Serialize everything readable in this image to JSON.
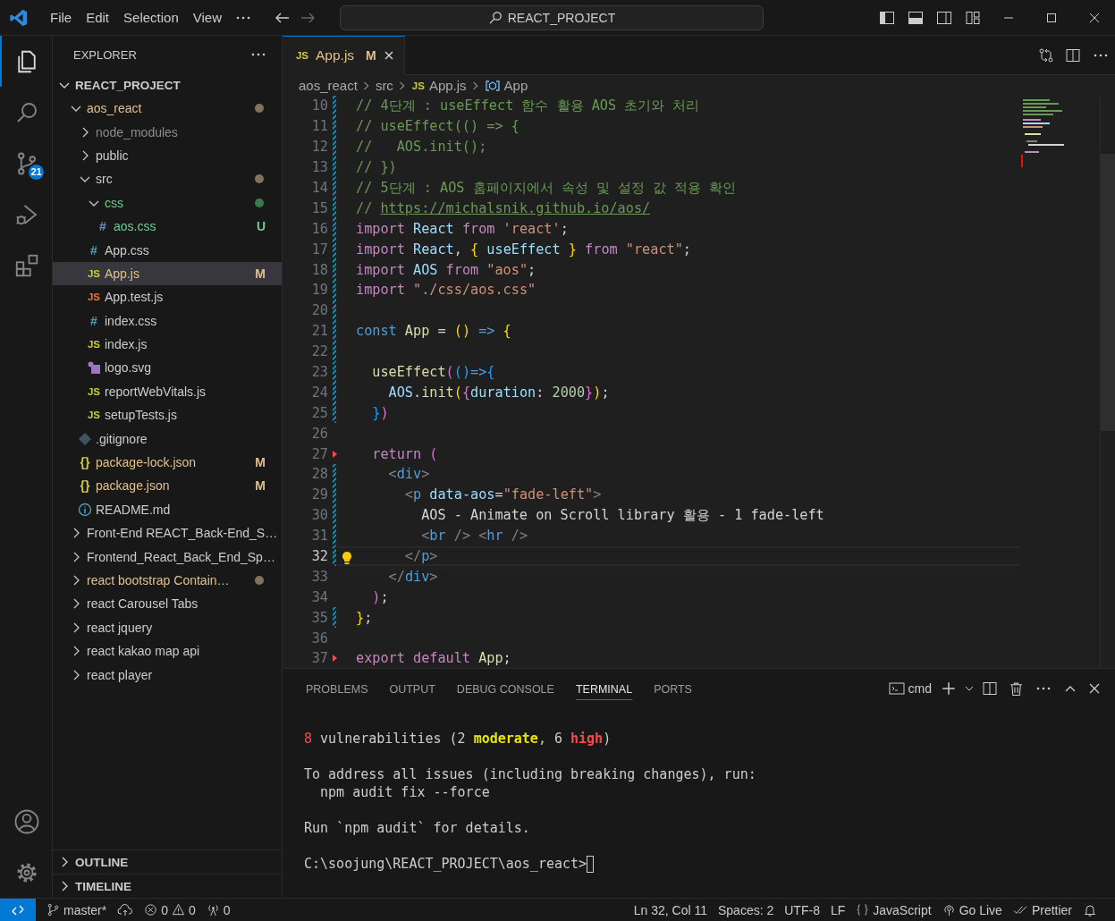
{
  "title_bar": {
    "menus": [
      {
        "label": "File"
      },
      {
        "label": "Edit"
      },
      {
        "label": "Selection"
      },
      {
        "label": "View"
      }
    ],
    "command_center": {
      "label": "REACT_PROJECT"
    }
  },
  "activity_bar": {
    "items": [
      {
        "kind": "explorer",
        "selected": true
      },
      {
        "kind": "search",
        "selected": false
      },
      {
        "kind": "source_control",
        "selected": false,
        "badge": "21"
      },
      {
        "kind": "run_debug",
        "selected": false
      },
      {
        "kind": "extensions",
        "selected": false
      }
    ],
    "bottom": [
      {
        "kind": "accounts"
      },
      {
        "kind": "settings"
      }
    ]
  },
  "sidebar": {
    "title": "EXPLORER",
    "section": {
      "label": "REACT_PROJECT",
      "expanded": true
    },
    "tree": [
      {
        "kind": "folder",
        "label": "aos_react",
        "expanded": true,
        "color": "#e2c08d",
        "dot": {
          "color": "#857359"
        },
        "selected": false,
        "children": [
          {
            "kind": "folder",
            "label": "node_modules",
            "expanded": false,
            "color": "#8c8c8c",
            "selected": false
          },
          {
            "kind": "folder",
            "label": "public",
            "expanded": false,
            "color": "#cccccc",
            "selected": false
          },
          {
            "kind": "folder",
            "label": "src",
            "expanded": true,
            "color": "#cccccc",
            "dot": {
              "color": "#857359"
            },
            "selected": false,
            "children": [
              {
                "kind": "folder",
                "label": "css",
                "expanded": true,
                "color": "#73c991",
                "dot": {
                  "color": "#3f7a4f"
                },
                "selected": false,
                "children": [
                  {
                    "kind": "css",
                    "glyph": "#",
                    "label": "aos.css",
                    "color": "#73c991",
                    "badge": "U",
                    "selected": false
                  }
                ]
              },
              {
                "kind": "css",
                "glyph": "#",
                "label": "App.css",
                "color": "#cccccc",
                "selected": false
              },
              {
                "kind": "js",
                "glyph": "JS",
                "label": "App.js",
                "color": "#e2c08d",
                "badge": "M",
                "selected": true
              },
              {
                "kind": "jstest",
                "glyph": "JS",
                "label": "App.test.js",
                "color": "#cccccc",
                "selected": false
              },
              {
                "kind": "css",
                "glyph": "#",
                "label": "index.css",
                "color": "#cccccc",
                "selected": false
              },
              {
                "kind": "js",
                "glyph": "JS",
                "label": "index.js",
                "color": "#cccccc",
                "selected": false
              },
              {
                "kind": "image",
                "label": "logo.svg",
                "color": "#cccccc",
                "selected": false
              },
              {
                "kind": "js",
                "glyph": "JS",
                "label": "reportWebVitals.js",
                "color": "#cccccc",
                "selected": false
              },
              {
                "kind": "js",
                "glyph": "JS",
                "label": "setupTests.js",
                "color": "#cccccc",
                "selected": false
              }
            ]
          },
          {
            "kind": "git",
            "label": ".gitignore",
            "color": "#cccccc",
            "selected": false
          },
          {
            "kind": "json",
            "glyph": "{}",
            "label": "package-lock.json",
            "color": "#e2c08d",
            "badge": "M",
            "selected": false
          },
          {
            "kind": "json",
            "glyph": "{}",
            "label": "package.json",
            "color": "#e2c08d",
            "badge": "M",
            "selected": false
          },
          {
            "kind": "info",
            "label": "README.md",
            "color": "#cccccc",
            "selected": false
          }
        ]
      },
      {
        "kind": "folder",
        "label": "Front-End REACT_Back-End_S…",
        "expanded": false,
        "color": "#cccccc",
        "selected": false
      },
      {
        "kind": "folder",
        "label": "Frontend_React_Back_End_Sp…",
        "expanded": false,
        "color": "#cccccc",
        "selected": false
      },
      {
        "kind": "folder",
        "label": "react bootstrap Contain…",
        "expanded": false,
        "color": "#e2c08d",
        "dot": {
          "color": "#857359"
        },
        "selected": false
      },
      {
        "kind": "folder",
        "label": "react Carousel Tabs",
        "expanded": false,
        "color": "#cccccc",
        "selected": false
      },
      {
        "kind": "folder",
        "label": "react jquery",
        "expanded": false,
        "color": "#cccccc",
        "selected": false
      },
      {
        "kind": "folder",
        "label": "react kakao map api",
        "expanded": false,
        "color": "#cccccc",
        "selected": false
      },
      {
        "kind": "folder",
        "label": "react player",
        "expanded": false,
        "color": "#cccccc",
        "selected": false
      }
    ],
    "collapsed_sections": [
      {
        "label": "OUTLINE",
        "expanded": false
      },
      {
        "label": "TIMELINE",
        "expanded": false
      }
    ]
  },
  "editor": {
    "tabs": [
      {
        "label": "App.js",
        "glyph": "JS",
        "badge": "M",
        "color": "#e2c08d",
        "selected": true
      }
    ],
    "breadcrumbs": [
      {
        "label": "aos_react"
      },
      {
        "label": "src"
      },
      {
        "label": "App.js",
        "glyph": "JS"
      },
      {
        "label": "App",
        "kind": "symbol"
      }
    ],
    "lines": [
      {
        "number": "10",
        "kind": "modified",
        "current": false,
        "tokens": [
          {
            "text": "// 4단계 : useEffect 함수 활용 AOS 초기와 처리",
            "kind": "comment"
          }
        ]
      },
      {
        "number": "11",
        "kind": "modified",
        "current": false,
        "tokens": [
          {
            "text": "// useEffect(() => {",
            "kind": "comment"
          }
        ]
      },
      {
        "number": "12",
        "kind": "modified",
        "current": false,
        "tokens": [
          {
            "text": "//   AOS.init();",
            "kind": "comment"
          }
        ]
      },
      {
        "number": "13",
        "kind": "modified",
        "current": false,
        "tokens": [
          {
            "text": "// })",
            "kind": "comment"
          }
        ]
      },
      {
        "number": "14",
        "kind": "modified",
        "current": false,
        "tokens": [
          {
            "text": "// 5단계 : AOS 홈페이지에서 속성 및 설정 값 적용 확인",
            "kind": "comment"
          }
        ]
      },
      {
        "number": "15",
        "kind": "modified",
        "current": false,
        "tokens": [
          {
            "text": "// ",
            "kind": "comment"
          },
          {
            "text": "https://michalsnik.github.io/aos/",
            "kind": "link"
          }
        ]
      },
      {
        "number": "16",
        "kind": "modified",
        "current": false,
        "tokens": [
          {
            "text": "import",
            "kind": "kw"
          },
          {
            "text": " React ",
            "kind": "var"
          },
          {
            "text": "from",
            "kind": "kw"
          },
          {
            "text": " 'react'",
            "kind": "str"
          },
          {
            "text": ";",
            "kind": "plain"
          }
        ]
      },
      {
        "number": "17",
        "kind": "modified",
        "current": false,
        "tokens": [
          {
            "text": "import",
            "kind": "kw"
          },
          {
            "text": " React",
            "kind": "var"
          },
          {
            "text": ", ",
            "kind": "plain"
          },
          {
            "text": "{",
            "kind": "b1"
          },
          {
            "text": " useEffect ",
            "kind": "var"
          },
          {
            "text": "}",
            "kind": "b1"
          },
          {
            "text": " from",
            "kind": "kw"
          },
          {
            "text": " \"react\"",
            "kind": "str"
          },
          {
            "text": ";",
            "kind": "plain"
          }
        ]
      },
      {
        "number": "18",
        "kind": "modified",
        "current": false,
        "tokens": [
          {
            "text": "import",
            "kind": "kw"
          },
          {
            "text": " AOS ",
            "kind": "var"
          },
          {
            "text": "from",
            "kind": "kw"
          },
          {
            "text": " \"aos\"",
            "kind": "str"
          },
          {
            "text": ";",
            "kind": "plain"
          }
        ]
      },
      {
        "number": "19",
        "kind": "modified",
        "current": false,
        "tokens": [
          {
            "text": "import",
            "kind": "kw"
          },
          {
            "text": " \"./css/aos.css\"",
            "kind": "str"
          }
        ]
      },
      {
        "number": "20",
        "kind": "modified",
        "current": false
      },
      {
        "number": "21",
        "kind": "modified",
        "current": false,
        "tokens": [
          {
            "text": "const",
            "kind": "dec"
          },
          {
            "text": " App",
            "kind": "fn"
          },
          {
            "text": " = ",
            "kind": "plain"
          },
          {
            "text": "()",
            "kind": "b1"
          },
          {
            "text": " => ",
            "kind": "dec"
          },
          {
            "text": "{",
            "kind": "b1"
          }
        ]
      },
      {
        "number": "22",
        "kind": "modified",
        "current": false
      },
      {
        "number": "23",
        "kind": "modified",
        "current": false,
        "tokens": [
          {
            "text": "  useEffect",
            "kind": "fn"
          },
          {
            "text": "(",
            "kind": "b2"
          },
          {
            "text": "()",
            "kind": "b3"
          },
          {
            "text": "=>",
            "kind": "dec"
          },
          {
            "text": "{",
            "kind": "b3"
          }
        ]
      },
      {
        "number": "24",
        "kind": "modified",
        "current": false,
        "tokens": [
          {
            "text": "    AOS",
            "kind": "var"
          },
          {
            "text": ".",
            "kind": "plain"
          },
          {
            "text": "init",
            "kind": "fn"
          },
          {
            "text": "(",
            "kind": "b1"
          },
          {
            "text": "{",
            "kind": "b2"
          },
          {
            "text": "duration",
            "kind": "var"
          },
          {
            "text": ": ",
            "kind": "plain"
          },
          {
            "text": "2000",
            "kind": "num"
          },
          {
            "text": "}",
            "kind": "b2"
          },
          {
            "text": ")",
            "kind": "b1"
          },
          {
            "text": ";",
            "kind": "plain"
          }
        ]
      },
      {
        "number": "25",
        "kind": "modified",
        "current": false,
        "tokens": [
          {
            "text": "  }",
            "kind": "b3"
          },
          {
            "text": ")",
            "kind": "b2"
          }
        ]
      },
      {
        "number": "26",
        "kind": "unchanged",
        "current": false
      },
      {
        "number": "27",
        "kind": "deleted",
        "current": false,
        "tokens": [
          {
            "text": "  return ",
            "kind": "kw"
          },
          {
            "text": "(",
            "kind": "b2"
          }
        ]
      },
      {
        "number": "28",
        "kind": "modified",
        "current": false,
        "tokens": [
          {
            "text": "    <",
            "kind": "tag"
          },
          {
            "text": "div",
            "kind": "tagname"
          },
          {
            "text": ">",
            "kind": "tag"
          }
        ]
      },
      {
        "number": "29",
        "kind": "modified",
        "current": false,
        "tokens": [
          {
            "text": "      <",
            "kind": "tag"
          },
          {
            "text": "p",
            "kind": "tagname"
          },
          {
            "text": " data-aos",
            "kind": "var"
          },
          {
            "text": "=",
            "kind": "plain"
          },
          {
            "text": "\"fade-left\"",
            "kind": "str"
          },
          {
            "text": ">",
            "kind": "tag"
          }
        ]
      },
      {
        "number": "30",
        "kind": "modified",
        "current": false,
        "tokens": [
          {
            "text": "        AOS - Animate on Scroll library 활용 - 1 fade-left",
            "kind": "plain"
          }
        ]
      },
      {
        "number": "31",
        "kind": "modified",
        "current": false,
        "tokens": [
          {
            "text": "        <",
            "kind": "tag"
          },
          {
            "text": "br",
            "kind": "tagname"
          },
          {
            "text": " />",
            "kind": "tag"
          },
          {
            "text": " <",
            "kind": "tag"
          },
          {
            "text": "hr",
            "kind": "tagname"
          },
          {
            "text": " />",
            "kind": "tag"
          }
        ]
      },
      {
        "number": "32",
        "kind": "modified",
        "current": true,
        "tokens": [
          {
            "text": "      </",
            "kind": "tag"
          },
          {
            "text": "p",
            "kind": "tagname"
          },
          {
            "text": ">",
            "kind": "tag"
          }
        ]
      },
      {
        "number": "33",
        "kind": "unchanged",
        "current": false,
        "tokens": [
          {
            "text": "    </",
            "kind": "tag"
          },
          {
            "text": "div",
            "kind": "tagname"
          },
          {
            "text": ">",
            "kind": "tag"
          }
        ]
      },
      {
        "number": "34",
        "kind": "unchanged",
        "current": false,
        "tokens": [
          {
            "text": "  )",
            "kind": "b2"
          },
          {
            "text": ";",
            "kind": "plain"
          }
        ]
      },
      {
        "number": "35",
        "kind": "modified",
        "current": false,
        "tokens": [
          {
            "text": "}",
            "kind": "b1"
          },
          {
            "text": ";",
            "kind": "plain"
          }
        ]
      },
      {
        "number": "36",
        "kind": "unchanged",
        "current": false
      },
      {
        "number": "37",
        "kind": "deleted",
        "current": false,
        "tokens": [
          {
            "text": "export default ",
            "kind": "kw"
          },
          {
            "text": "App",
            "kind": "fn"
          },
          {
            "text": ";",
            "kind": "plain"
          }
        ]
      }
    ]
  },
  "panel": {
    "tabs": [
      {
        "label": "PROBLEMS",
        "selected": false
      },
      {
        "label": "OUTPUT",
        "selected": false
      },
      {
        "label": "DEBUG CONSOLE",
        "selected": false
      },
      {
        "label": "TERMINAL",
        "selected": true
      },
      {
        "label": "PORTS",
        "selected": false
      }
    ],
    "terminal_picker": {
      "label": "cmd"
    },
    "terminal": {
      "cursor": true,
      "blocks": [
        [
          [
            {
              "text": "8",
              "kind": "red"
            },
            {
              "text": " vulnerabilities (2 ",
              "kind": "plain"
            },
            {
              "text": "moderate",
              "kind": "bold_yellow"
            },
            {
              "text": ", 6 ",
              "kind": "plain"
            },
            {
              "text": "high",
              "kind": "bold_red"
            },
            {
              "text": ")",
              "kind": "plain"
            }
          ]
        ],
        [
          [
            {
              "text": "To address all issues (including breaking changes), run:",
              "kind": "plain"
            }
          ],
          [
            {
              "text": "  npm audit fix --force",
              "kind": "plain"
            }
          ]
        ],
        [
          [
            {
              "text": "Run `npm audit` for details.",
              "kind": "plain"
            }
          ]
        ],
        [
          [
            {
              "text": "C:\\soojung\\REACT_PROJECT\\aos_react>",
              "kind": "plain"
            }
          ]
        ]
      ]
    }
  },
  "status_bar": {
    "left": [
      {
        "kind": "remote"
      },
      {
        "kind": "branch",
        "label": "master*"
      },
      {
        "kind": "sync"
      },
      {
        "kind": "problems",
        "errors": "0",
        "warnings": "0"
      },
      {
        "kind": "ports",
        "label": "0"
      }
    ],
    "right": [
      {
        "kind": "text",
        "label": "Ln 32, Col 11"
      },
      {
        "kind": "text",
        "label": "Spaces: 2"
      },
      {
        "kind": "text",
        "label": "UTF-8"
      },
      {
        "kind": "text",
        "label": "LF"
      },
      {
        "kind": "language",
        "label": "JavaScript"
      },
      {
        "kind": "golive",
        "label": "Go Live"
      },
      {
        "kind": "prettier",
        "label": "Prettier"
      },
      {
        "kind": "bell"
      }
    ]
  }
}
